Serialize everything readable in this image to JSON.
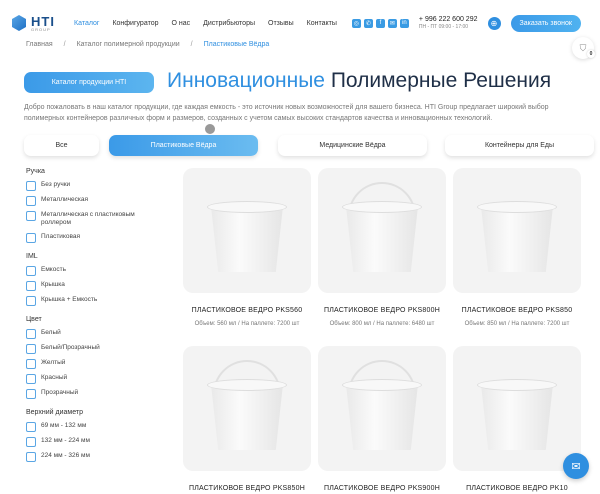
{
  "brand": {
    "name": "HTI",
    "sub": "GROUP"
  },
  "nav": [
    "Каталог",
    "Конфигуратор",
    "О нас",
    "Дистрибьюторы",
    "Отзывы",
    "Контакты"
  ],
  "social": [
    "IG",
    "WA",
    "FB",
    "M",
    "in"
  ],
  "phone": {
    "number": "+ 996 222 600 292",
    "hours": "ПН - ПТ 09:00 - 17:00"
  },
  "call_button": "Заказать звонок",
  "breadcrumbs": [
    "Главная",
    "Каталог полимерной продукции",
    "Пластиковые Вёдра"
  ],
  "cart_count": "0",
  "catalog_button": "Каталог продукции HTI",
  "title": {
    "highlight": "Инновационные",
    "rest": "Полимерные Решения"
  },
  "intro": "Добро пожаловать в наш каталог продукции, где каждая емкость - это источник новых возможностей для вашего бизнеса. HTI Group предлагает широкий выбор полимерных контейнеров различных форм и размеров, созданных с учетом самых высоких стандартов качества и инновационных технологий.",
  "tabs": [
    "Все",
    "Пластиковые Вёдра",
    "Медицинские Вёдра",
    "Контейнеры для Еды"
  ],
  "filters": [
    {
      "title": "Ручка",
      "items": [
        "Без ручки",
        "Металлическая",
        "Металлическая с пластиковым роллером",
        "Пластиковая"
      ]
    },
    {
      "title": "IML",
      "items": [
        "Емкость",
        "Крышка",
        "Крышка + Емкость"
      ]
    },
    {
      "title": "Цвет",
      "items": [
        "Белый",
        "Белый/Прозрачный",
        "Желтый",
        "Красный",
        "Прозрачный"
      ]
    },
    {
      "title": "Верхний диаметр",
      "items": [
        "69 мм - 132 мм",
        "132 мм - 224 мм",
        "224 мм - 326 мм"
      ]
    }
  ],
  "products": [
    {
      "name": "ПЛАСТИКОВОЕ ВЕДРО PKS560",
      "meta": "Объем: 560 мл / На паллете: 7200 шт",
      "handle": false
    },
    {
      "name": "ПЛАСТИКОВОЕ ВЕДРО PKS800H",
      "meta": "Объем: 800 мл / На паллете: 6480 шт",
      "handle": true
    },
    {
      "name": "ПЛАСТИКОВОЕ ВЕДРО PKS850",
      "meta": "Объем: 850 мл / На паллете: 7200 шт",
      "handle": false
    },
    {
      "name": "ПЛАСТИКОВОЕ ВЕДРО PKS850H",
      "meta": "",
      "handle": true
    },
    {
      "name": "ПЛАСТИКОВОЕ ВЕДРО PKS900H",
      "meta": "",
      "handle": true
    },
    {
      "name": "ПЛАСТИКОВОЕ ВЕДРО PK10",
      "meta": "",
      "handle": false
    }
  ]
}
